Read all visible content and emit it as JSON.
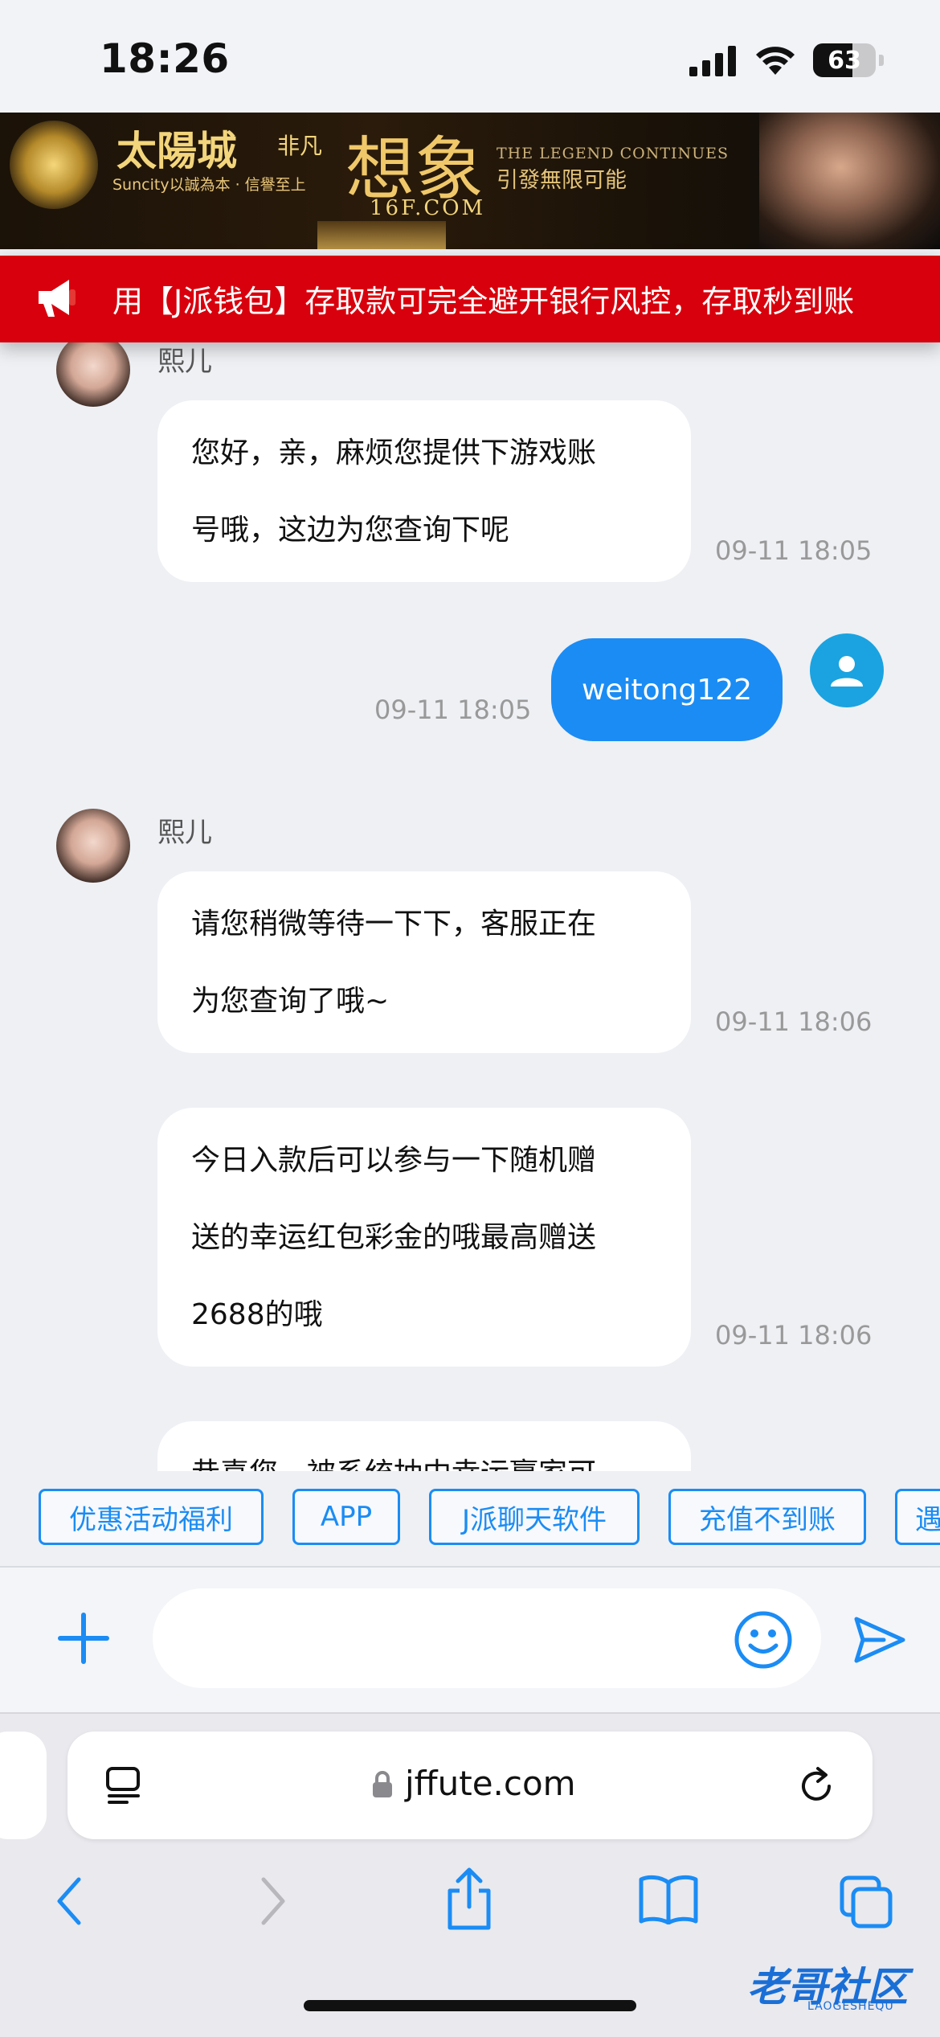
{
  "status_bar": {
    "time": "18:26",
    "battery": "63",
    "battery_level": 0.63
  },
  "banner": {
    "brand": "太陽城",
    "fei": "非凡",
    "xiang": "想象",
    "tagline": "Suncity以誠為本 · 信譽至上",
    "legend": "THE LEGEND CONTINUES",
    "slogan": "引發無限可能",
    "domain": "16F.COM"
  },
  "notice": {
    "text": "用【J派钱包】存取款可完全避开银行风控，存取秒到账"
  },
  "chat": {
    "messages": [
      {
        "sender": "熙儿",
        "lines": [
          "您好，亲，麻烦您提供下游戏账",
          "号哦，这边为您查询下呢"
        ],
        "time": "09-11 18:05"
      },
      {
        "self": true,
        "text": "weitong122",
        "time": "09-11 18:05"
      },
      {
        "sender": "熙儿",
        "lines": [
          " 请您稍微等待一下下，客服正在",
          "为您查询了哦~"
        ],
        "time": "09-11 18:06"
      },
      {
        "lines": [
          "今日入款后可以参与一下随机赠",
          "送的幸运红包彩金的哦最高赠送",
          "2688的哦"
        ],
        "time": "09-11 18:06"
      },
      {
        "lines": [
          "恭喜您，被系统抽中幸运赢家可"
        ]
      }
    ]
  },
  "quick_replies": [
    "优惠活动福利",
    "APP",
    "J派聊天软件",
    "充值不到账",
    "遇"
  ],
  "input": {
    "placeholder": ""
  },
  "safari": {
    "url": "jffute.com"
  },
  "watermark": {
    "text": "老哥社区",
    "sub": "LAOGESHEQU"
  }
}
